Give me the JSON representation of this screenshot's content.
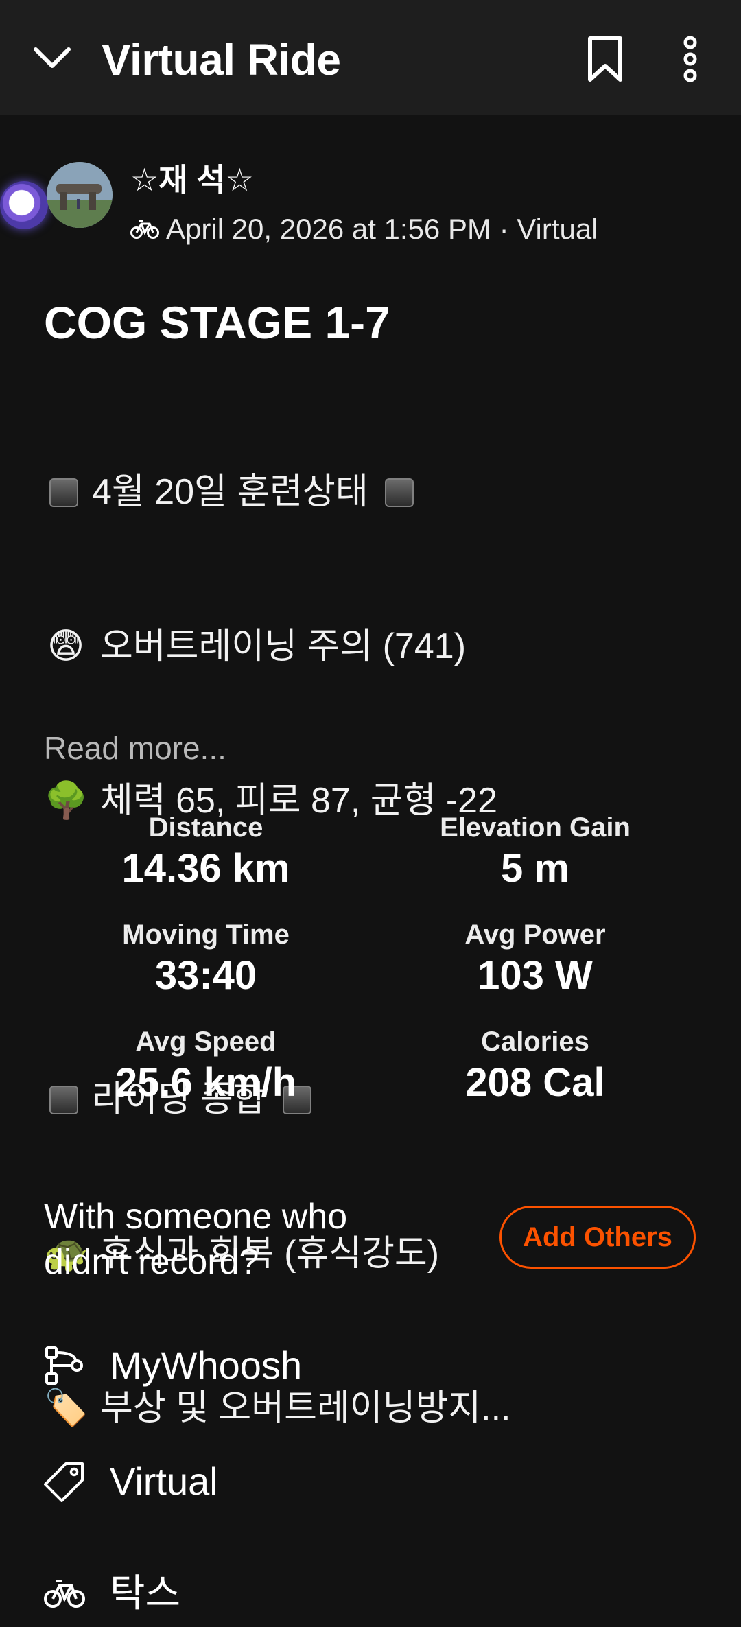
{
  "header": {
    "title": "Virtual Ride"
  },
  "user": {
    "name": "☆재 석☆",
    "meta": "April 20, 2026 at 1:56 PM · Virtual"
  },
  "activity": {
    "title": "COG STAGE 1-7",
    "description": {
      "line1": "4월 20일 훈련상태",
      "line2_emoji": "😨",
      "line2": "오버트레이닝 주의 (741)",
      "line3_emoji": "🌳",
      "line3": "체력 65, 피로 87, 균형 -22",
      "line4": "라이딩 종합",
      "line5_emoji": "🐢",
      "line5": "휴식과 회복 (휴식강도)",
      "line6_emoji": "🏷️",
      "line6": "부상 및 오버트레이닝방지..."
    },
    "read_more": "Read more..."
  },
  "stats": [
    {
      "label": "Distance",
      "value": "14.36 km"
    },
    {
      "label": "Elevation Gain",
      "value": "5 m"
    },
    {
      "label": "Moving Time",
      "value": "33:40"
    },
    {
      "label": "Avg Power",
      "value": "103 W"
    },
    {
      "label": "Avg Speed",
      "value": "25.6 km/h"
    },
    {
      "label": "Calories",
      "value": "208 Cal"
    }
  ],
  "others": {
    "prompt": "With someone who didn't record?",
    "button": "Add Others"
  },
  "details": {
    "app": "MyWhoosh",
    "tag": "Virtual",
    "bike": "탁스"
  },
  "colors": {
    "accent": "#fc5200",
    "background": "#121212",
    "header": "#1e1e1e"
  }
}
